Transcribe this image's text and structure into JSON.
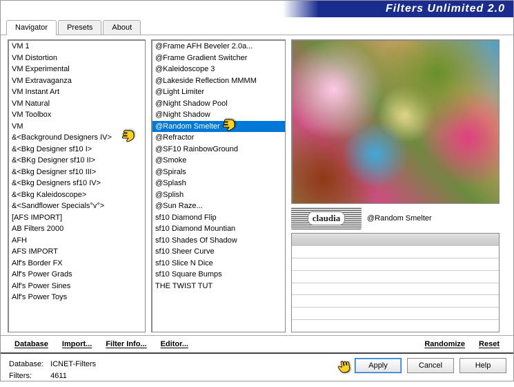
{
  "title": "Filters Unlimited 2.0",
  "tabs": [
    {
      "label": "Navigator",
      "active": true
    },
    {
      "label": "Presets",
      "active": false
    },
    {
      "label": "About",
      "active": false
    }
  ],
  "categories": [
    "VM 1",
    "VM Distortion",
    "VM Experimental",
    "VM Extravaganza",
    "VM Instant Art",
    "VM Natural",
    "VM Toolbox",
    "VM",
    "&<Background Designers IV>",
    "&<Bkg Designer sf10 I>",
    "&<BKg Designer sf10 II>",
    "&<Bkg Designer sf10 III>",
    "&<Bkg Designers sf10 IV>",
    "&<Bkg Kaleidoscope>",
    "&<Sandflower Specials°v°>",
    "[AFS IMPORT]",
    "AB Filters 2000",
    "AFH",
    "AFS IMPORT",
    "Alf's Border FX",
    "Alf's Power Grads",
    "Alf's Power Sines",
    "Alf's Power Toys"
  ],
  "selected_category_index": 8,
  "filters": [
    "@Frame AFH Beveler 2.0a...",
    "@Frame Gradient Switcher",
    "@Kaleidoscope 3",
    "@Lakeside Reflection MMMM",
    "@Light Limiter",
    "@Night Shadow Pool",
    "@Night Shadow",
    "@Random Smelter",
    "@Refractor",
    "@SF10 RainbowGround",
    "@Smoke",
    "@Spirals",
    "@Splash",
    "@Splish",
    "@Sun Raze...",
    "sf10 Diamond Flip",
    "sf10 Diamond Mountian",
    "sf10 Shades Of Shadow",
    "sf10 Sheer Curve",
    "sf10 Slice N Dice",
    "sf10 Square Bumps",
    "THE TWIST TUT"
  ],
  "selected_filter_index": 7,
  "current_filter_label": "@Random Smelter",
  "watermark_text": "claudia",
  "toolbar": {
    "database": "Database",
    "import": "Import...",
    "filter_info": "Filter Info...",
    "editor": "Editor...",
    "randomize": "Randomize",
    "reset": "Reset"
  },
  "footer": {
    "db_label": "Database:",
    "db_value": "ICNET-Filters",
    "filters_label": "Filters:",
    "filters_value": "4611",
    "apply": "Apply",
    "cancel": "Cancel",
    "help": "Help"
  },
  "colors": {
    "selection": "#0078d7",
    "titlebar": "#1a2d8f",
    "pointer_fill": "#ffd21e",
    "pointer_stroke": "#111"
  }
}
